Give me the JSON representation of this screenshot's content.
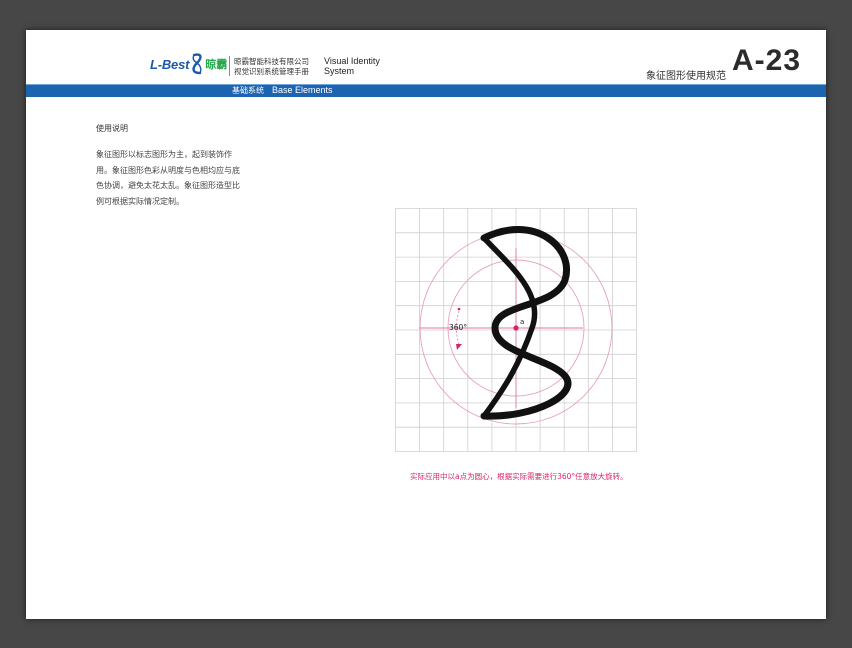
{
  "header": {
    "logo_text": "L-Best",
    "logo_cn": "晾霸",
    "company_line1": "晾霸智能科技有限公司",
    "company_line2": "视觉识别系统管理手册",
    "vis_line1": "Visual Identity",
    "vis_line2": "System",
    "page_title": "象征图形使用规范",
    "page_code": "A-23"
  },
  "band": {
    "section_cn": "基础系统",
    "section_en": "Base Elements"
  },
  "instructions": {
    "title": "使用说明",
    "body": "象征图形以标志图形为主，起到装饰作用。象征图形色彩从明度与色相均应与底色协调，避免太花太乱。象征图形造型比例可根据实际情况定制。"
  },
  "diagram": {
    "angle_label": "360°",
    "point_label": "a"
  },
  "caption": "实际应用中以a点为圆心，根据实际需要进行360°任意放大旋转。",
  "colors": {
    "brand_blue": "#1c63b0",
    "brand_green": "#22a64a",
    "accent_pink": "#d6246a",
    "background": "#474747"
  }
}
